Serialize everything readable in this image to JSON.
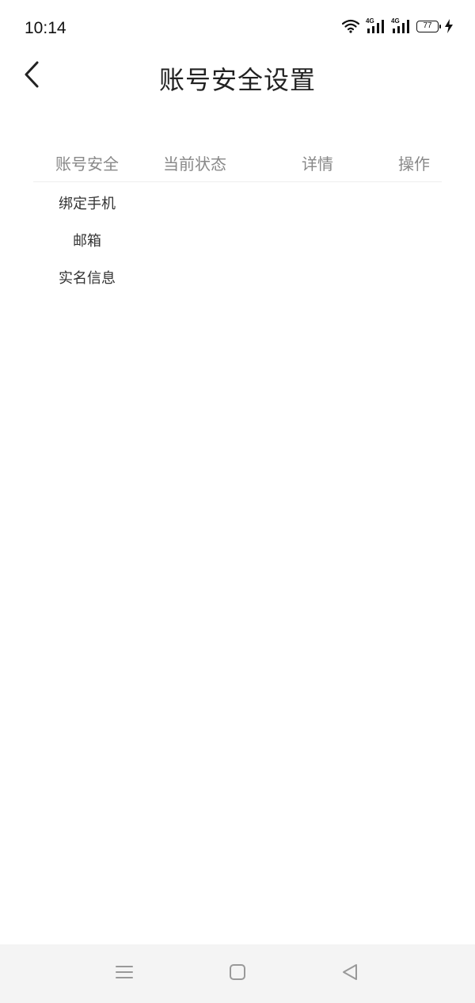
{
  "status_bar": {
    "time": "10:14",
    "network_1": "4G",
    "network_2": "4G",
    "battery": "77"
  },
  "header": {
    "title": "账号安全设置",
    "back_icon": "chevron-left-icon"
  },
  "table": {
    "columns": [
      "账号安全",
      "当前状态",
      "详情",
      "操作"
    ],
    "rows": [
      {
        "item": "绑定手机",
        "status": "",
        "detail": "",
        "action": ""
      },
      {
        "item": "邮箱",
        "status": "",
        "detail": "",
        "action": ""
      },
      {
        "item": "实名信息",
        "status": "",
        "detail": "",
        "action": ""
      }
    ]
  },
  "nav_bar": {
    "menu_icon": "menu-icon",
    "home_icon": "home-square-icon",
    "back_icon": "back-triangle-icon"
  },
  "colors": {
    "title": "#222222",
    "column_header": "#888888",
    "cell_text": "#333333",
    "divider": "#eeeeee",
    "nav_background": "#f4f4f4",
    "nav_icon": "#999999"
  }
}
